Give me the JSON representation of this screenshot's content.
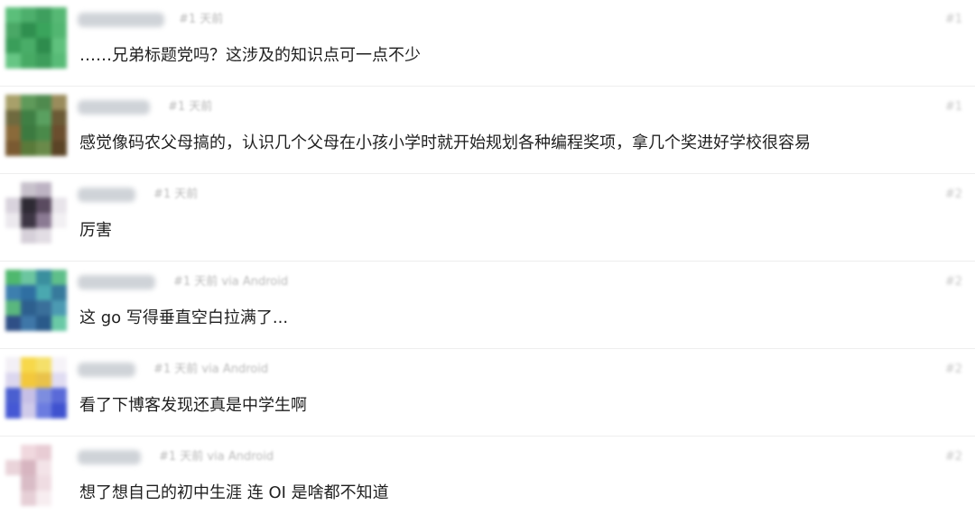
{
  "comments": [
    {
      "meta": "#1 天前",
      "index": "#1",
      "text": "……兄弟标题党吗？这涉及的知识点可一点不少",
      "avatar_colors": [
        "#5bbf7a",
        "#4daf6c",
        "#3e9f5e",
        "#56b874",
        "#4aa866",
        "#2f8f4f",
        "#3aa45c",
        "#52b671",
        "#3a9e5a",
        "#49ad68",
        "#2e8c4d",
        "#5fc17d",
        "#66c684",
        "#47aa64",
        "#3d9d5b",
        "#58bb77"
      ]
    },
    {
      "meta": "#1 天前",
      "index": "#1",
      "text": "感觉像码农父母搞的，认识几个父母在小孩小学时就开始规划各种编程奖项，拿几个奖进好学校很容易",
      "avatar_colors": [
        "#a8a06a",
        "#5f9a5a",
        "#4f8a4e",
        "#9a8c5c",
        "#6f6a3f",
        "#3f7f44",
        "#5aa060",
        "#6b5a35",
        "#8a6a3a",
        "#3c7a40",
        "#4a8a4a",
        "#6b4e2e",
        "#7a5a32",
        "#5a7a3a",
        "#6a8a4a",
        "#5b4426"
      ]
    },
    {
      "meta": "#1 天前",
      "index": "#2",
      "text": "厉害",
      "avatar_colors": [
        "#ffffff",
        "#c7c1cb",
        "#bdb3c3",
        "#ffffff",
        "#d9d3dd",
        "#2e2a34",
        "#5a4b60",
        "#e8e4ea",
        "#ece9ee",
        "#3d3644",
        "#8b7a93",
        "#f2f0f3",
        "#ffffff",
        "#d6d0d9",
        "#e2dde4",
        "#ffffff"
      ]
    },
    {
      "meta": "#1 天前 via Android",
      "index": "#2",
      "text": "这 go 写得垂直空白拉满了...",
      "avatar_colors": [
        "#4fb86e",
        "#6cc6a0",
        "#3a8f9e",
        "#5fbf8a",
        "#3d7fae",
        "#2f6fa2",
        "#4aa8b0",
        "#377a9c",
        "#5ab77e",
        "#2d5f8e",
        "#3a6f9a",
        "#4c9ab2",
        "#2f4f86",
        "#3f77a8",
        "#2a5a8a",
        "#6ac9a6"
      ]
    },
    {
      "meta": "#1 天前 via Android",
      "index": "#2",
      "text": "看了下博客发现还真是中学生啊",
      "avatar_colors": [
        "#f3f0f6",
        "#f7d84a",
        "#f5e06a",
        "#f6f3f8",
        "#dcd7ef",
        "#f3c83c",
        "#e9c24a",
        "#e0dcf2",
        "#4a5fd0",
        "#c7c0e6",
        "#7d8ddf",
        "#5a6ad8",
        "#4558d4",
        "#d0cbea",
        "#6b7ce0",
        "#3f52cf"
      ]
    },
    {
      "meta": "#1 天前 via Android",
      "index": "#2",
      "text": "想了想自己的初中生涯 连 OI 是啥都不知道",
      "avatar_colors": [
        "#ffffff",
        "#f0d8de",
        "#e8ccd4",
        "#ffffff",
        "#ead4da",
        "#d7b5c0",
        "#f3e3e8",
        "#ffffff",
        "#ffffff",
        "#d9bcc6",
        "#efdce2",
        "#ffffff",
        "#ffffff",
        "#e6cfd6",
        "#f7edf0",
        "#ffffff"
      ]
    }
  ]
}
